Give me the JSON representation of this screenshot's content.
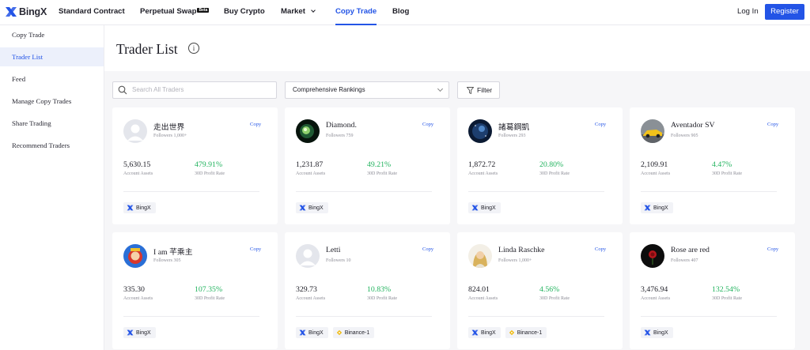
{
  "brand": {
    "name": "BingX",
    "accent": "#2354e6",
    "profit_color": "#22b35e"
  },
  "nav": {
    "items": [
      {
        "label": "Standard Contract"
      },
      {
        "label": "Perpetual Swap",
        "badge": "Beta"
      },
      {
        "label": "Buy Crypto"
      },
      {
        "label": "Market"
      },
      {
        "label": "Copy Trade",
        "active": true
      },
      {
        "label": "Blog"
      }
    ],
    "login": "Log In",
    "register": "Register"
  },
  "sidebar": {
    "items": [
      {
        "label": "Copy Trade"
      },
      {
        "label": "Trader List",
        "active": true
      },
      {
        "label": "Feed"
      },
      {
        "label": "Manage Copy Trades"
      },
      {
        "label": "Share Trading"
      },
      {
        "label": "Recommend Traders"
      }
    ]
  },
  "page": {
    "title": "Trader List",
    "info_icon": "i"
  },
  "filters": {
    "search_placeholder": "Search All Traders",
    "ranking_selected": "Comprehensive Rankings",
    "filter_label": "Filter"
  },
  "card_labels": {
    "copy": "Copy",
    "assets": "Account Assets",
    "profit": "30D Profit Rate"
  },
  "traders": [
    {
      "name": "走出世界",
      "followers": "Followers 1,000+",
      "assets": "5,630.15",
      "profit": "479.91%",
      "avatar": "default-avatar-icon",
      "exchanges": [
        "BingX"
      ]
    },
    {
      "name": "Diamond.",
      "followers": "Followers 759",
      "assets": "1,231.87",
      "profit": "49.21%",
      "avatar": "nebula-avatar",
      "exchanges": [
        "BingX"
      ]
    },
    {
      "name": "諸葛鋼凱",
      "followers": "Followers 293",
      "assets": "1,872.72",
      "profit": "20.80%",
      "avatar": "night-sky-avatar",
      "exchanges": [
        "BingX"
      ]
    },
    {
      "name": "Aventador SV",
      "followers": "Followers 905",
      "assets": "2,109.91",
      "profit": "4.47%",
      "avatar": "car-avatar",
      "exchanges": [
        "BingX"
      ]
    },
    {
      "name": "I am 芊乘主",
      "followers": "Followers 305",
      "assets": "335.30",
      "profit": "107.35%",
      "avatar": "cartoon-avatar",
      "exchanges": [
        "BingX"
      ]
    },
    {
      "name": "Letti",
      "followers": "Followers 10",
      "assets": "329.73",
      "profit": "10.83%",
      "avatar": "default-avatar-icon",
      "exchanges": [
        "BingX",
        "Binance-1"
      ]
    },
    {
      "name": "Linda Raschke",
      "followers": "Followers 1,000+",
      "assets": "824.01",
      "profit": "4.56%",
      "avatar": "portrait-avatar",
      "exchanges": [
        "BingX",
        "Binance-1"
      ]
    },
    {
      "name": "Rose are red",
      "followers": "Followers 407",
      "assets": "3,476.94",
      "profit": "132.54%",
      "avatar": "rose-avatar",
      "exchanges": [
        "BingX"
      ]
    }
  ]
}
